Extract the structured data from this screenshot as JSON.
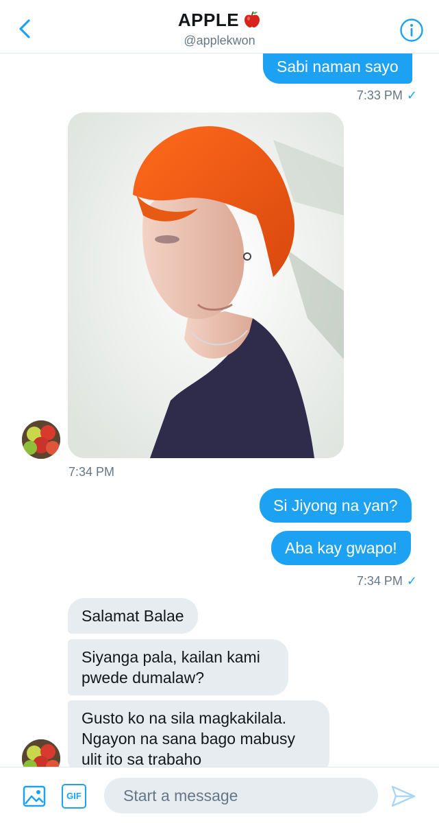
{
  "header": {
    "title": "APPLE",
    "handle": "@applekwon",
    "title_emoji_icon": "red-apple-icon",
    "back_icon": "chevron-left-icon",
    "info_icon": "info-icon"
  },
  "messages": [
    {
      "direction": "out",
      "text": "Sabi naman sayo"
    },
    {
      "direction": "out_time",
      "text": "7:33 PM"
    },
    {
      "direction": "in_image",
      "alt": "photo"
    },
    {
      "direction": "in_time",
      "text": "7:34 PM"
    },
    {
      "direction": "out",
      "text": "Si Jiyong na yan?"
    },
    {
      "direction": "out",
      "text": "Aba kay gwapo!"
    },
    {
      "direction": "out_time",
      "text": "7:34 PM"
    },
    {
      "direction": "in",
      "text": "Salamat Balae"
    },
    {
      "direction": "in",
      "text": "Siyanga pala, kailan kami pwede dumalaw?"
    },
    {
      "direction": "in",
      "text": "Gusto ko na sila magkakilala. Ngayon na sana bago mabusy ulit ito sa trabaho"
    }
  ],
  "read_tick": "✓",
  "composer": {
    "placeholder": "Start a message",
    "gif_label": "GIF",
    "image_icon": "image-icon",
    "send_icon": "send-icon"
  },
  "colors": {
    "accent": "#1da1f2",
    "incoming_bubble": "#e6ecf0",
    "muted_text": "#657786"
  }
}
